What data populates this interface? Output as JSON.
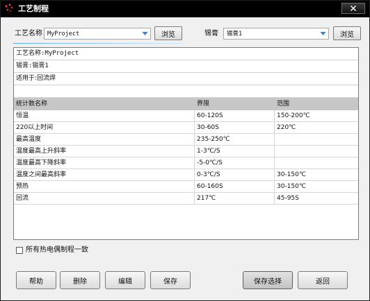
{
  "window": {
    "title": "工艺制程"
  },
  "project": {
    "label": "工艺名称",
    "value": "MyProject",
    "browse_label": "浏览"
  },
  "paste": {
    "label": "锡膏",
    "value": "锡膏1",
    "browse_label": "浏览"
  },
  "info": {
    "name_line": "工艺名称:MyProject",
    "paste_line": "锡膏:锡膏1",
    "usage_line": "适用于:回流焊"
  },
  "table": {
    "headers": [
      "统计数名称",
      "界限",
      "范围"
    ],
    "rows": [
      [
        "恒温",
        "60-120S",
        "150-200℃"
      ],
      [
        "220以上时间",
        "30-60S",
        "220℃"
      ],
      [
        "最高温度",
        "235-250℃",
        ""
      ],
      [
        "温度最高上升斜率",
        "1-3℃/S",
        ""
      ],
      [
        "温度最高下降斜率",
        "-5-0℃/S",
        ""
      ],
      [
        "温度之间最高斜率",
        "0-3℃/S",
        "30-150℃"
      ],
      [
        "预热",
        "60-160S",
        "30-150℃"
      ],
      [
        "回流",
        "217℃",
        "45-95S"
      ]
    ]
  },
  "checkbox": {
    "label": "所有热电偶制程一致",
    "checked": false
  },
  "buttons": {
    "help": "帮助",
    "delete": "删除",
    "edit": "编辑",
    "save": "保存",
    "save_selection": "保存选择",
    "back": "返回"
  },
  "icons": {
    "app": "dots-icon",
    "close": "close-icon",
    "dropdown": "chevron-down-icon"
  },
  "colors": {
    "titlebar": "#000000",
    "accent": "#1e90ff",
    "header_row": "#c7c7c7"
  }
}
